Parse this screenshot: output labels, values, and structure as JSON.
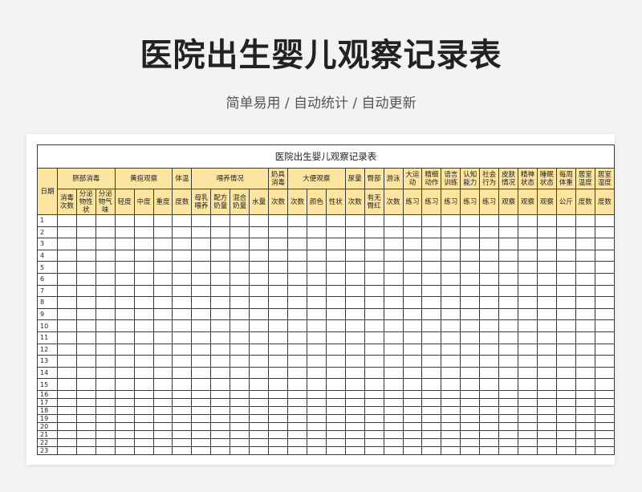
{
  "page": {
    "title": "医院出生婴儿观察记录表",
    "subtitle": "简单易用 / 自动统计 / 自动更新"
  },
  "sheet": {
    "title": "医院出生婴儿观察记录表",
    "date_header": "日期",
    "groups": [
      {
        "label": "脐部消毒",
        "span": 3
      },
      {
        "label": "黄疸观察",
        "span": 3
      },
      {
        "label": "体温",
        "span": 1
      },
      {
        "label": "喂养情况",
        "span": 4
      },
      {
        "label": "奶具消毒",
        "span": 1
      },
      {
        "label": "大便观察",
        "span": 3
      },
      {
        "label": "尿量",
        "span": 1
      },
      {
        "label": "臀部",
        "span": 1
      },
      {
        "label": "游泳",
        "span": 1
      },
      {
        "label": "大运动",
        "span": 1
      },
      {
        "label": "精细动作",
        "span": 1
      },
      {
        "label": "语言训练",
        "span": 1
      },
      {
        "label": "认知能力",
        "span": 1
      },
      {
        "label": "社会行为",
        "span": 1
      },
      {
        "label": "皮肤情况",
        "span": 1
      },
      {
        "label": "精神状态",
        "span": 1
      },
      {
        "label": "睡眠状态",
        "span": 1
      },
      {
        "label": "每周体重",
        "span": 1
      },
      {
        "label": "居室温度",
        "span": 1
      },
      {
        "label": "居室湿度",
        "span": 1
      }
    ],
    "subheaders": [
      "消毒次数",
      "分泌物性状",
      "分泌物气味",
      "轻度",
      "中度",
      "重度",
      "度数",
      "母乳喂养",
      "配方奶量",
      "混合奶量",
      "水量",
      "次数",
      "次数",
      "颜色",
      "性状",
      "次数",
      "有无臀红",
      "次数",
      "练习",
      "练习",
      "练习",
      "练习",
      "练习",
      "观察",
      "观察",
      "观察",
      "公斤",
      "度数",
      "度数"
    ],
    "row_numbers": [
      "1",
      "2",
      "3",
      "4",
      "5",
      "6",
      "7",
      "8",
      "9",
      "10",
      "11",
      "12",
      "13",
      "14",
      "15",
      "16",
      "17",
      "18",
      "19",
      "20",
      "21",
      "22",
      "23"
    ]
  }
}
